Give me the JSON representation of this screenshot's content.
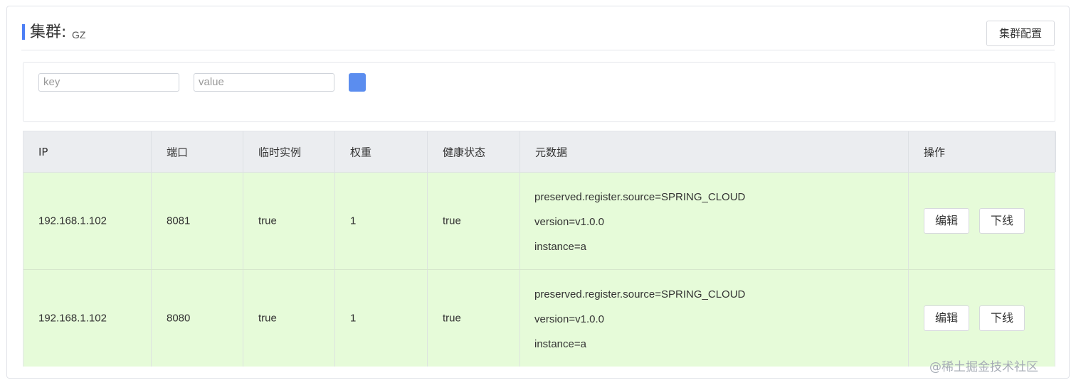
{
  "header": {
    "title": "集群:",
    "cluster_name": "GZ",
    "cluster_config_button": "集群配置"
  },
  "filter": {
    "key_placeholder": "key",
    "value_placeholder": "value",
    "search_button_icon": "search-icon"
  },
  "table": {
    "columns": [
      "IP",
      "端口",
      "临时实例",
      "权重",
      "健康状态",
      "元数据",
      "操作"
    ],
    "rows": [
      {
        "ip": "192.168.1.102",
        "port": "8081",
        "ephemeral": "true",
        "weight": "1",
        "healthy": "true",
        "metadata": [
          "preserved.register.source=SPRING_CLOUD",
          "version=v1.0.0",
          "instance=a"
        ],
        "edit_label": "编辑",
        "offline_label": "下线"
      },
      {
        "ip": "192.168.1.102",
        "port": "8080",
        "ephemeral": "true",
        "weight": "1",
        "healthy": "true",
        "metadata": [
          "preserved.register.source=SPRING_CLOUD",
          "version=v1.0.0",
          "instance=a"
        ],
        "edit_label": "编辑",
        "offline_label": "下线"
      }
    ]
  },
  "watermark": "@稀土掘金技术社区",
  "colors": {
    "accent": "#4d7ff5",
    "search_button": "#5b8def",
    "row_background": "#e6fbd9",
    "header_background": "#ebedf0"
  }
}
